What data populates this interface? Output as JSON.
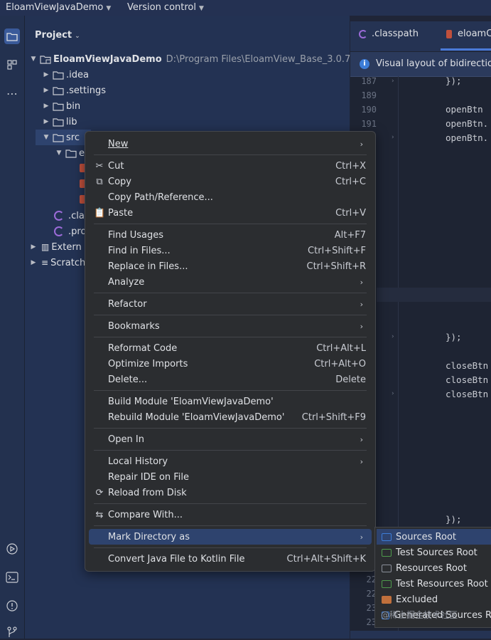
{
  "topbar": {
    "project_name": "EloamViewJavaDemo",
    "vcs": "Version control"
  },
  "project_panel": {
    "title": "Project",
    "tree": [
      {
        "label": "EloamViewJavaDemo",
        "path": "D:\\Program Files\\EloamView_Base_3.0.7\\sam"
      },
      {
        "label": ".idea"
      },
      {
        "label": ".settings"
      },
      {
        "label": "bin"
      },
      {
        "label": "lib"
      },
      {
        "label": "src"
      },
      {
        "label": "e"
      },
      {
        "label": ".clas"
      },
      {
        "label": ".pro"
      },
      {
        "label": "Extern"
      },
      {
        "label": "Scratch"
      }
    ]
  },
  "editor": {
    "tabs": [
      ".classpath",
      "eloamC"
    ],
    "notice": "Visual layout of bidirection",
    "lines": [
      {
        "n": "187",
        "code": "});"
      },
      {
        "n": "189",
        "code": ""
      },
      {
        "n": "190",
        "code": "openBtn"
      },
      {
        "n": "191",
        "code": "openBtn."
      },
      {
        "n": "",
        "code": "openBtn."
      },
      {
        "n": "",
        "code": "});"
      },
      {
        "n": "",
        "code": "closeBtn"
      },
      {
        "n": "",
        "code": "closeBtn"
      },
      {
        "n": "",
        "code": "closeBtn"
      },
      {
        "n": "",
        "code": "});"
      },
      {
        "n": "22",
        "code": ""
      },
      {
        "n": "22",
        "code": ""
      },
      {
        "n": "23",
        "code": ""
      },
      {
        "n": "23",
        "code": ""
      }
    ]
  },
  "context_menu": {
    "items": [
      {
        "label": "New",
        "shortcut": "",
        "submenu": true
      },
      {
        "label": "Cut",
        "shortcut": "Ctrl+X",
        "icon": "cut-icon"
      },
      {
        "label": "Copy",
        "shortcut": "Ctrl+C",
        "icon": "copy-icon"
      },
      {
        "label": "Copy Path/Reference...",
        "shortcut": ""
      },
      {
        "label": "Paste",
        "shortcut": "Ctrl+V",
        "icon": "paste-icon"
      },
      {
        "label": "Find Usages",
        "shortcut": "Alt+F7"
      },
      {
        "label": "Find in Files...",
        "shortcut": "Ctrl+Shift+F"
      },
      {
        "label": "Replace in Files...",
        "shortcut": "Ctrl+Shift+R"
      },
      {
        "label": "Analyze",
        "shortcut": "",
        "submenu": true
      },
      {
        "label": "Refactor",
        "shortcut": "",
        "submenu": true
      },
      {
        "label": "Bookmarks",
        "shortcut": "",
        "submenu": true
      },
      {
        "label": "Reformat Code",
        "shortcut": "Ctrl+Alt+L"
      },
      {
        "label": "Optimize Imports",
        "shortcut": "Ctrl+Alt+O"
      },
      {
        "label": "Delete...",
        "shortcut": "Delete"
      },
      {
        "label": "Build Module 'EloamViewJavaDemo'",
        "shortcut": ""
      },
      {
        "label": "Rebuild Module 'EloamViewJavaDemo'",
        "shortcut": "Ctrl+Shift+F9"
      },
      {
        "label": "Open In",
        "shortcut": "",
        "submenu": true
      },
      {
        "label": "Local History",
        "shortcut": "",
        "submenu": true
      },
      {
        "label": "Repair IDE on File",
        "shortcut": ""
      },
      {
        "label": "Reload from Disk",
        "shortcut": "",
        "icon": "reload-icon"
      },
      {
        "label": "Compare With...",
        "shortcut": "",
        "icon": "compare-icon"
      },
      {
        "label": "Mark Directory as",
        "shortcut": "",
        "submenu": true,
        "selected": true
      },
      {
        "label": "Convert Java File to Kotlin File",
        "shortcut": "Ctrl+Alt+Shift+K"
      }
    ]
  },
  "submenu": {
    "items": [
      {
        "label": "Sources Root",
        "color": "#3d7dd8"
      },
      {
        "label": "Test Sources Root",
        "color": "#4e9a4c"
      },
      {
        "label": "Resources Root",
        "color": "#8a8f99"
      },
      {
        "label": "Test Resources Root",
        "color": "#4e9a4c"
      },
      {
        "label": "Excluded",
        "color": "#c0703c"
      },
      {
        "label": "Generated Sources R",
        "color": "#3d7dd8"
      }
    ]
  },
  "watermark": "@稀土掘金技术社区"
}
